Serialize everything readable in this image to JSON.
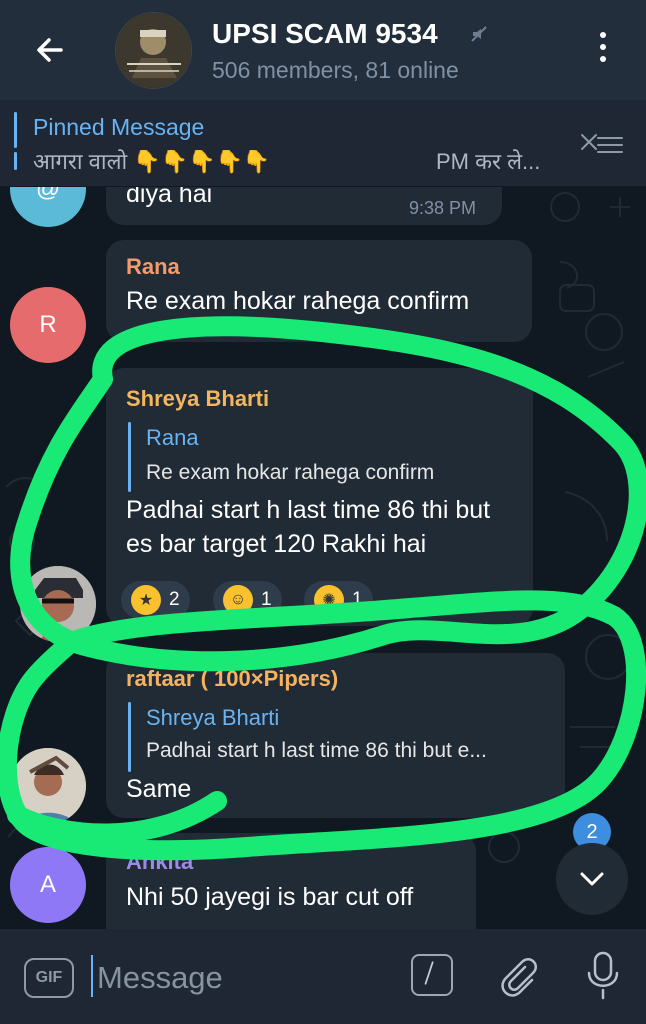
{
  "header": {
    "title": "UPSI SCAM 9534",
    "subtitle": "506 members, 81 online",
    "colors": {
      "background": "#232e3c",
      "accent": "#6ab3f3"
    }
  },
  "pinned": {
    "title": "Pinned Message",
    "text": "आगरा वालो 👇👇👇👇👇",
    "trail": "PM कर ले..."
  },
  "messages": [
    {
      "avatar_letter": "@",
      "text": "diya hai",
      "time": "9:38 PM"
    },
    {
      "sender": "Rana",
      "avatar_letter": "R",
      "text": "Re exam hokar rahega confirm"
    },
    {
      "sender": "Shreya Bharti",
      "reply_to": {
        "name": "Rana",
        "text": "Re exam hokar rahega confirm"
      },
      "text": "Padhai start h last time 86 thi but es bar target 120 Rakhi hai",
      "reactions": [
        {
          "emoji": "🤩",
          "count": "2"
        },
        {
          "emoji": "😁",
          "count": "1"
        },
        {
          "emoji": "🤯",
          "count": "1"
        }
      ]
    },
    {
      "sender": "raftaar ( 100×Pipers)",
      "reply_to": {
        "name": "Shreya Bharti",
        "text": "Padhai start h last time 86 thi but e..."
      },
      "text": "Same"
    },
    {
      "sender": "Ankita",
      "avatar_letter": "A",
      "text": "Nhi 50 jayegi is bar cut off"
    }
  ],
  "unread_count": "2",
  "composer": {
    "gif_label": "GIF",
    "placeholder": "Message"
  }
}
